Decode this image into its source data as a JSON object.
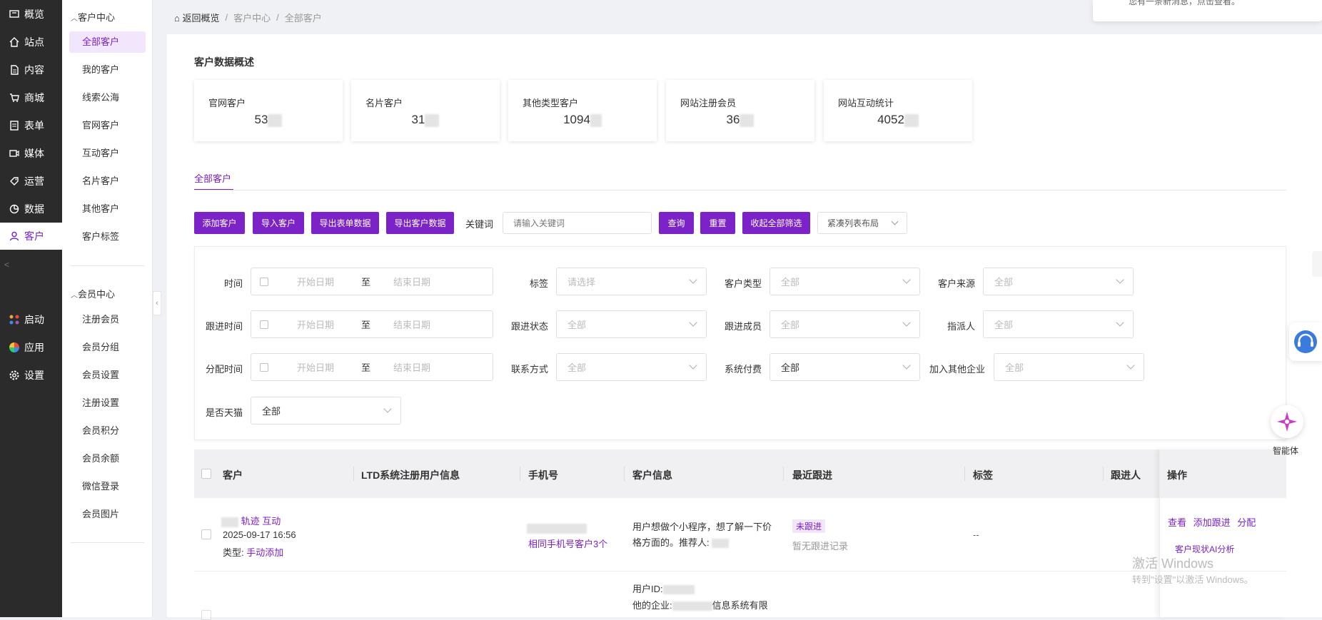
{
  "leftnav": {
    "items": [
      {
        "label": "概览",
        "icon": "overview-icon"
      },
      {
        "label": "站点",
        "icon": "home-icon"
      },
      {
        "label": "内容",
        "icon": "document-icon"
      },
      {
        "label": "商城",
        "icon": "cart-icon"
      },
      {
        "label": "表单",
        "icon": "form-icon"
      },
      {
        "label": "媒体",
        "icon": "video-icon"
      },
      {
        "label": "运营",
        "icon": "tag-icon"
      },
      {
        "label": "数据",
        "icon": "chart-icon"
      },
      {
        "label": "客户",
        "icon": "user-icon"
      }
    ],
    "bottom": [
      {
        "label": "启动",
        "icon": "launch-icon"
      },
      {
        "label": "应用",
        "icon": "apps-icon"
      },
      {
        "label": "设置",
        "icon": "gear-icon"
      }
    ]
  },
  "subnav": {
    "group1": "客户中心",
    "items1": [
      "全部客户",
      "我的客户",
      "线索公海",
      "官网客户",
      "互动客户",
      "名片客户",
      "其他客户",
      "客户标签"
    ],
    "group2": "会员中心",
    "items2": [
      "注册会员",
      "会员分组",
      "会员设置",
      "注册设置",
      "会员积分",
      "会员余额",
      "微信登录",
      "会员图片"
    ]
  },
  "breadcrumb": {
    "home": "返回概览",
    "level1": "客户中心",
    "level2": "全部客户",
    "sep": "/"
  },
  "notification": {
    "text": "您有一条新消息，点击查看。"
  },
  "overview": {
    "title": "客户数据概述",
    "stats": [
      {
        "label": "官网客户",
        "value": "53"
      },
      {
        "label": "名片客户",
        "value": "31"
      },
      {
        "label": "其他类型客户",
        "value": "1094"
      },
      {
        "label": "网站注册会员",
        "value": "36"
      },
      {
        "label": "网站互动统计",
        "value": "4052"
      }
    ]
  },
  "tabs": {
    "active": "全部客户"
  },
  "toolbar": {
    "add": "添加客户",
    "import": "导入客户",
    "export_form": "导出表单数据",
    "export_customer": "导出客户数据",
    "keyword_label": "关键词",
    "keyword_placeholder": "请输入关键词",
    "search": "查询",
    "reset": "重置",
    "collapse": "收起全部筛选",
    "layout": "紧凑列表布局"
  },
  "filters": {
    "time": "时间",
    "follow_time": "跟进时间",
    "assign_time": "分配时间",
    "tmall": "是否天猫",
    "start": "开始日期",
    "to": "至",
    "end": "结束日期",
    "tag": "标签",
    "tag_ph": "请选择",
    "follow_status": "跟进状态",
    "contact": "联系方式",
    "cust_type": "客户类型",
    "follow_member": "跟进成员",
    "sys_pay": "系统付费",
    "source": "客户来源",
    "assignee": "指派人",
    "join_other": "加入其他企业",
    "all": "全部"
  },
  "table": {
    "headers": [
      "客户",
      "LTD系统注册用户信息",
      "手机号",
      "客户信息",
      "最近跟进",
      "标签",
      "跟进人",
      "操作"
    ],
    "row1": {
      "trail": "轨迹",
      "interact": "互动",
      "date": "2025-09-17 16:56",
      "type_label": "类型:",
      "type": "手动添加",
      "same_phone": "相同手机号客户3个",
      "info": "用户想做个小程序，想了解一下价格方面的。推荐人:",
      "badge": "未跟进",
      "no_record": "暂无跟进记录",
      "tag": "--",
      "view": "查看",
      "add_follow": "添加跟进",
      "assign": "分配",
      "ai": "客户现状AI分析"
    },
    "row2": {
      "uid": "用户ID:",
      "company": "他的企业:",
      "company_suffix": "信息系统有限"
    }
  },
  "assistant": {
    "label": "智能体"
  },
  "watermark": {
    "line1": "激活 Windows",
    "line2": "转到\"设置\"以激活 Windows。"
  },
  "colors": {
    "accent": "#7b22c9",
    "sidebar": "#2b2b2b"
  }
}
